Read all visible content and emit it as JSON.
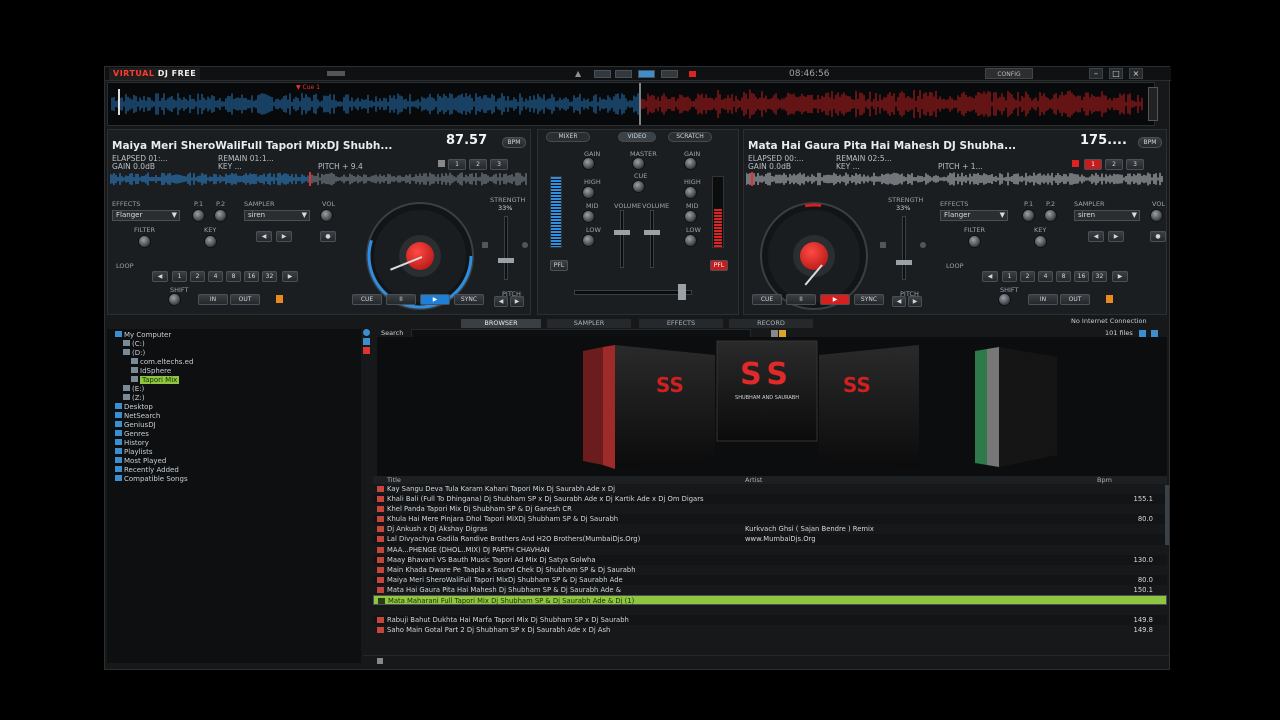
{
  "app": {
    "logo_red": "VIRTUAL",
    "logo_white": "DJ FREE",
    "clock": "08:46:56",
    "config_label": "CONFIG",
    "connection_status": "No Internet Connection",
    "file_count": "101 files"
  },
  "overview": {
    "cue_label": "Cue 1"
  },
  "deckA": {
    "title": "Maiya Meri SheroWaliFull Tapori MixDJ Shubh...",
    "bpm": "87.57",
    "bpm_unit": "BPM",
    "elapsed": "ELAPSED 01:...",
    "remain": "REMAIN 01:1...",
    "gain": "GAIN 0.0dB",
    "key": "KEY ...",
    "pitch": "PITCH + 9.4",
    "effects_label": "EFFECTS",
    "effect": "Flanger",
    "p1": "P.1",
    "p2": "P.2",
    "sampler_label": "SAMPLER",
    "sampler": "siren",
    "vol": "VOL",
    "filter": "FILTER",
    "keyknob": "KEY",
    "loop": "LOOP",
    "loop_sizes": [
      "1",
      "2",
      "4",
      "8",
      "16",
      "32"
    ],
    "shift": "SHIFT",
    "in": "IN",
    "out": "OUT",
    "strength": "STRENGTH",
    "pct": "33%",
    "cue": "CUE",
    "pause": "II",
    "play": "▶",
    "sync": "SYNC",
    "pitch_label": "PITCH"
  },
  "deckB": {
    "title": "Mata Hai Gaura Pita Hai Mahesh DJ Shubha...",
    "bpm": "175....",
    "bpm_unit": "BPM",
    "elapsed": "ELAPSED 00:...",
    "remain": "REMAIN 02:5...",
    "gain": "GAIN 0.0dB",
    "key": "KEY ...",
    "pitch": "PITCH + 1...",
    "effects_label": "EFFECTS",
    "effect": "Flanger",
    "p1": "P.1",
    "p2": "P.2",
    "sampler_label": "SAMPLER",
    "sampler": "siren",
    "vol": "VOL",
    "filter": "FILTER",
    "keyknob": "KEY",
    "loop": "LOOP",
    "loop_sizes": [
      "1",
      "2",
      "4",
      "8",
      "16",
      "32"
    ],
    "shift": "SHIFT",
    "in": "IN",
    "out": "OUT",
    "strength": "STRENGTH",
    "pct": "33%",
    "cue": "CUE",
    "pause": "II",
    "play": "▶",
    "sync": "SYNC",
    "pitch_label": "PITCH"
  },
  "mixer": {
    "tabs": [
      "MIXER",
      "VIDEO",
      "SCRATCH"
    ],
    "gain": "GAIN",
    "master": "MASTER",
    "cue": "CUE",
    "high": "HIGH",
    "mid": "MID",
    "low": "LOW",
    "volume": "VOLUME",
    "pfl": "PFL"
  },
  "browser": {
    "tabs": [
      "BROWSER",
      "SAMPLER",
      "EFFECTS",
      "RECORD"
    ],
    "search_label": "Search",
    "tree": [
      {
        "label": "My Computer",
        "indent": 0
      },
      {
        "label": "(C:)",
        "indent": 1
      },
      {
        "label": "(D:)",
        "indent": 1
      },
      {
        "label": "com.eltechs.ed",
        "indent": 2
      },
      {
        "label": "IdSphere",
        "indent": 2
      },
      {
        "label": "Tapori Mix",
        "indent": 2
      },
      {
        "label": "(E:)",
        "indent": 1
      },
      {
        "label": "(Z:)",
        "indent": 1
      },
      {
        "label": "Desktop",
        "indent": 0
      },
      {
        "label": "NetSearch",
        "indent": 0
      },
      {
        "label": "GeniusDJ",
        "indent": 0
      },
      {
        "label": "Genres",
        "indent": 0
      },
      {
        "label": "History",
        "indent": 0
      },
      {
        "label": "Playlists",
        "indent": 0
      },
      {
        "label": "Most Played",
        "indent": 0
      },
      {
        "label": "Recently Added",
        "indent": 0
      },
      {
        "label": "Compatible Songs",
        "indent": 0
      }
    ],
    "cover_text": "SS",
    "cover_sub": "SHUBHAM AND SAURABH",
    "columns": {
      "title": "Title",
      "artist": "Artist",
      "bpm": "Bpm"
    },
    "rows": [
      {
        "title": "Kay Sangu Deva Tula Karam Kahani Tapori Mix Dj Saurabh Ade x Dj",
        "artist": "",
        "bpm": ""
      },
      {
        "title": "Khali Bali (Full To Dhingana) Dj Shubham SP x Dj Saurabh Ade x Dj Kartik Ade x Dj Om Digars",
        "artist": "",
        "bpm": "155.1"
      },
      {
        "title": "Khel Panda Tapori Mix Dj Shubham SP & Dj Ganesh CR",
        "artist": "",
        "bpm": ""
      },
      {
        "title": "Khula Hai Mere Pinjara Dhol Tapori MiXDj Shubham SP & Dj Saurabh",
        "artist": "",
        "bpm": "80.0"
      },
      {
        "title": "Dj Ankush x Dj Akshay Digras",
        "artist": "Kurkvach Ghsi ( Sajan Bendre ) Remix",
        "bpm": ""
      },
      {
        "title": "Lal Divyachya Gadila Randive Brothers And H2O Brothers(MumbaiDjs.Org)",
        "artist": "www.MumbaiDjs.Org",
        "bpm": ""
      },
      {
        "title": "MAA...PHENGE (DHOL..MIX) DJ PARTH CHAVHAN",
        "artist": "",
        "bpm": ""
      },
      {
        "title": "Maay Bhavani VS Bauth Music Tapori Ad Mix Dj Satya Golwha",
        "artist": "",
        "bpm": "130.0"
      },
      {
        "title": "Main Khada Dware Pe Taapla x Sound Chek Dj Shubham SP & Dj Saurabh",
        "artist": "",
        "bpm": ""
      },
      {
        "title": "Maiya Meri SheroWaliFull Tapori MixDj Shubham SP & Dj Saurabh Ade",
        "artist": "",
        "bpm": "80.0"
      },
      {
        "title": "Mata Hai Gaura Pita Hai Mahesh Dj Shubham SP & Dj Saurabh Ade &",
        "artist": "",
        "bpm": "150.1"
      },
      {
        "title": "Mata Maharani Full Tapori Mix Dj Shubham SP & Dj Saurabh Ade & Dj (1)",
        "artist": "",
        "bpm": "",
        "selected": true
      },
      {
        "title": "",
        "artist": "",
        "bpm": ""
      },
      {
        "title": "Rabuji Bahut Dukhta Hai Marfa Tapori Mix Dj Shubham SP x Dj Saurabh",
        "artist": "",
        "bpm": "149.8"
      },
      {
        "title": "Saho Main Gotal Part 2 Dj Shubham SP x Dj Saurabh Ade x Dj Ash",
        "artist": "",
        "bpm": "149.8"
      }
    ]
  }
}
